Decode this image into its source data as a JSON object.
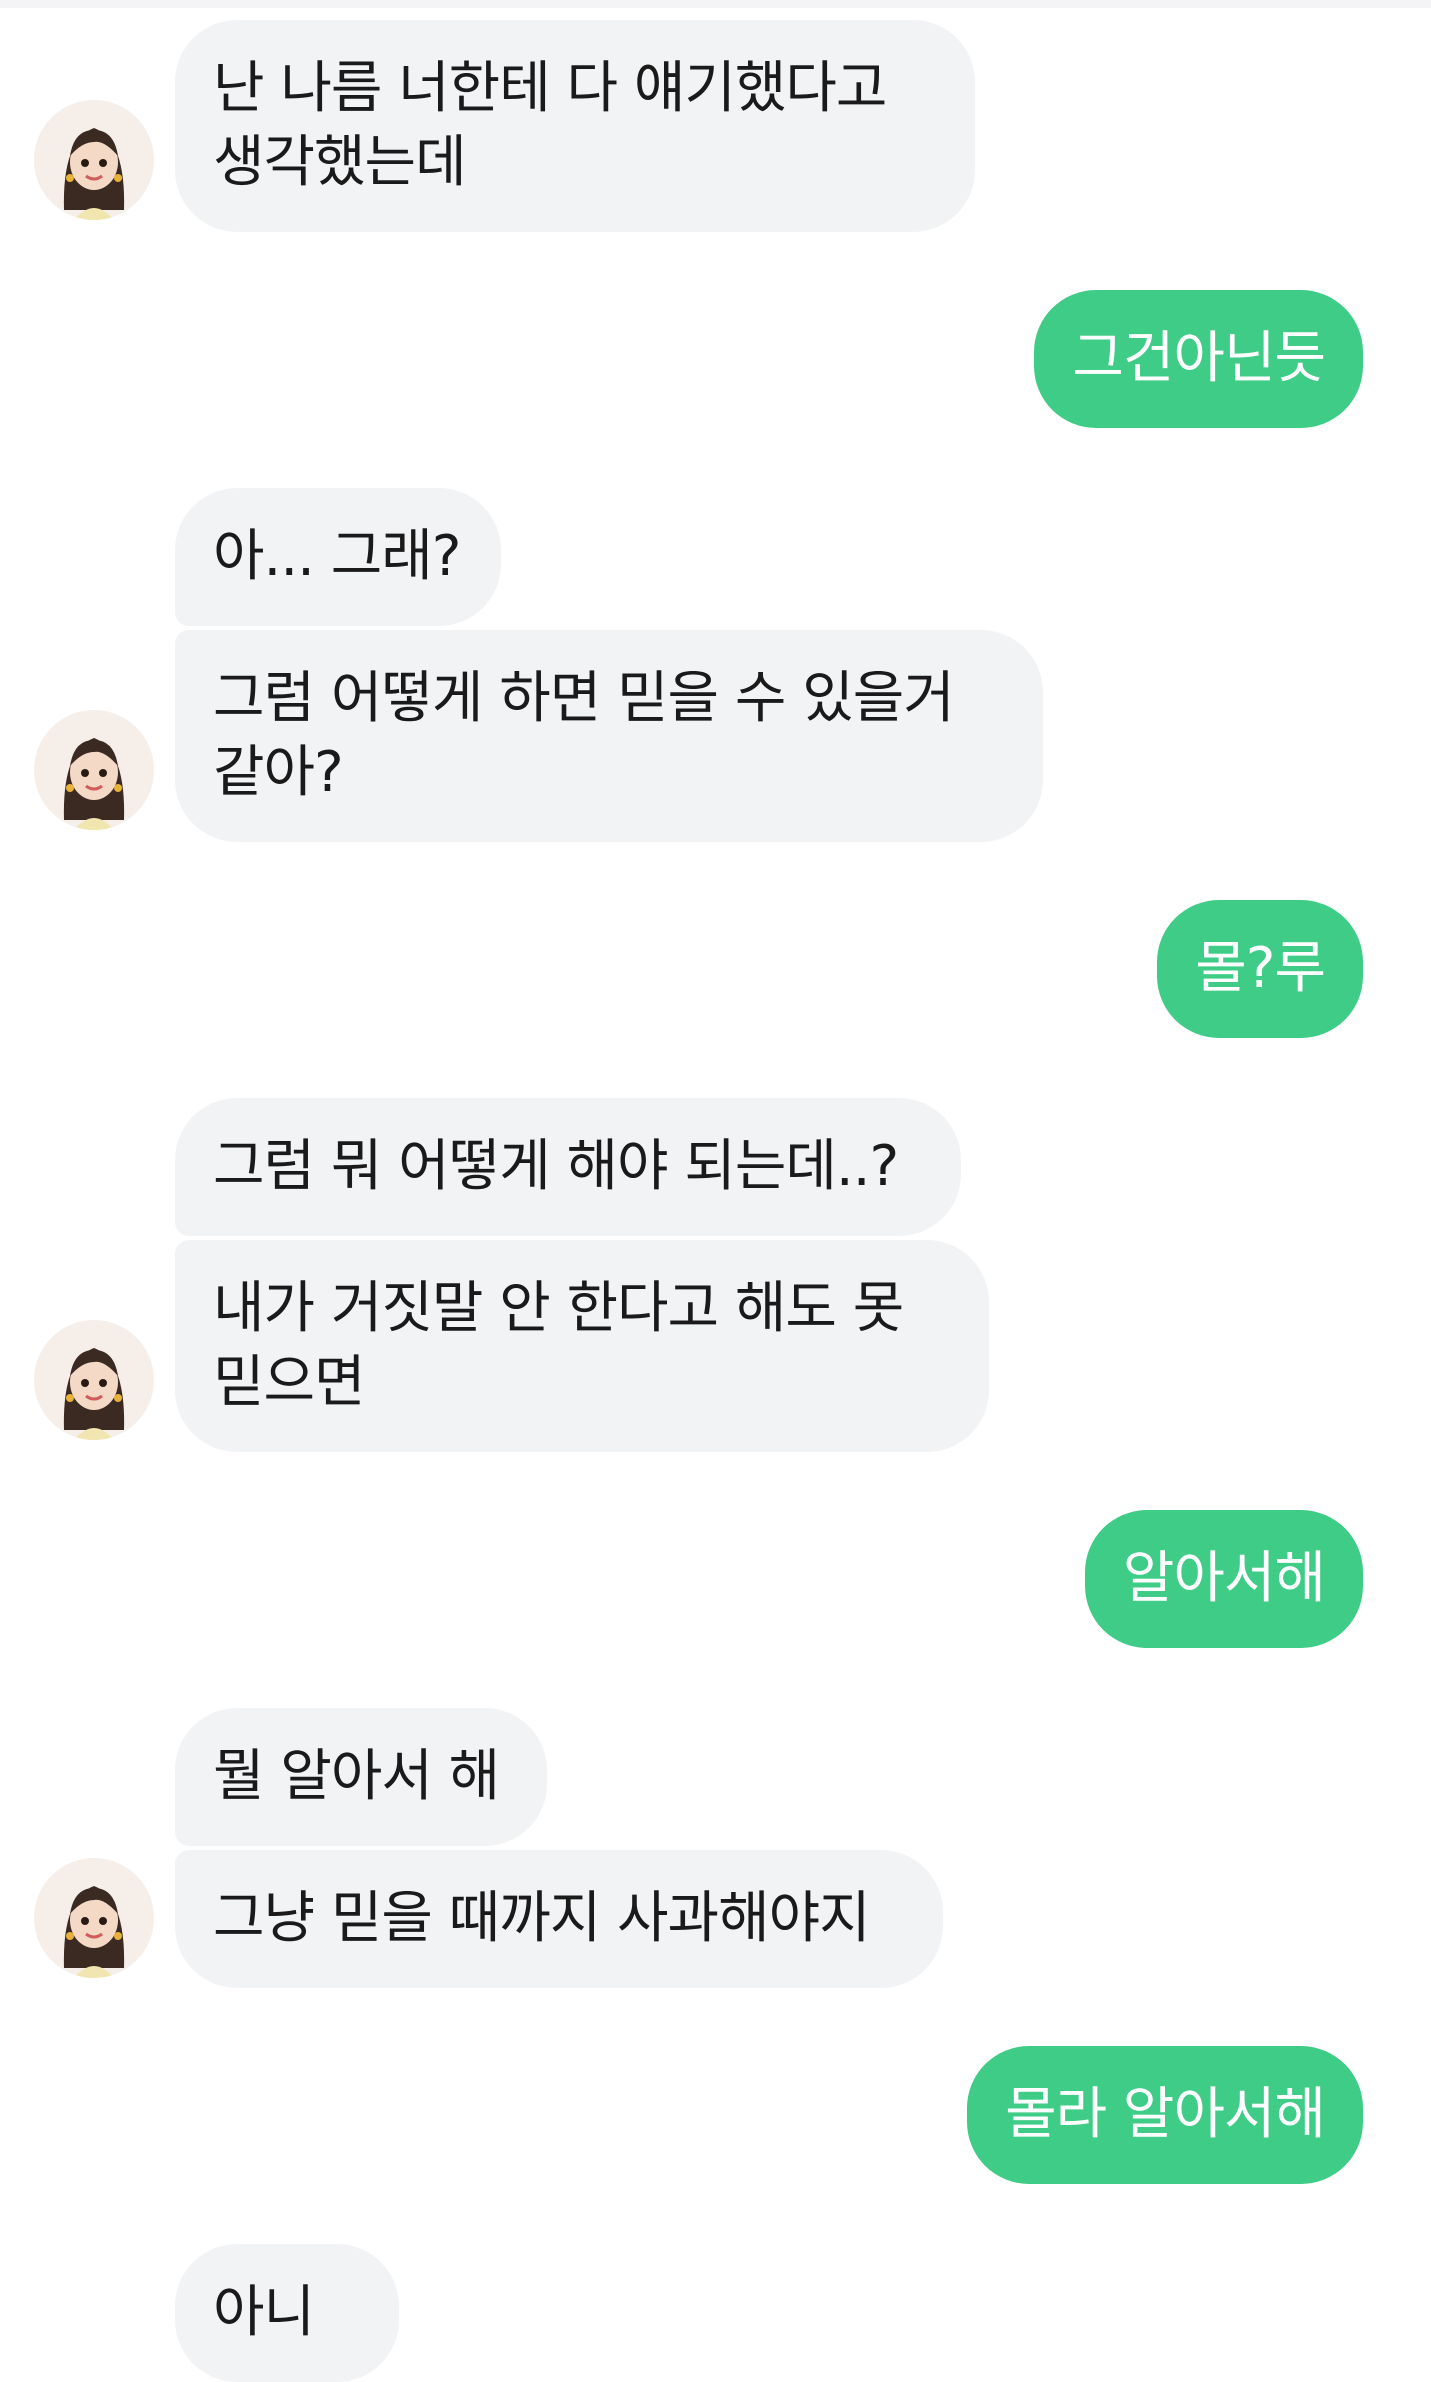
{
  "chat": {
    "messages": [
      {
        "side": "in",
        "text": "난 나름 너한테 다 얘기했다고\n생각했는데"
      },
      {
        "side": "out",
        "text": "그건아닌듯"
      },
      {
        "side": "in",
        "text": "아... 그래?"
      },
      {
        "side": "in",
        "text": "그럼 어떻게 하면 믿을 수 있을거\n같아?"
      },
      {
        "side": "out",
        "text": "몰?루"
      },
      {
        "side": "in",
        "text": "그럼 뭐 어떻게 해야 되는데..?"
      },
      {
        "side": "in",
        "text": "내가 거짓말 안 한다고 해도 못\n믿으면"
      },
      {
        "side": "out",
        "text": "알아서해"
      },
      {
        "side": "in",
        "text": "뭘 알아서 해"
      },
      {
        "side": "in",
        "text": "그냥 믿을 때까지 사과해야지"
      },
      {
        "side": "out",
        "text": "몰라 알아서해"
      },
      {
        "side": "in",
        "text": "아니"
      }
    ]
  },
  "colors": {
    "incoming_bubble": "#f2f3f5",
    "outgoing_bubble": "#3ecc87",
    "incoming_text": "#1a1a1a",
    "outgoing_text": "#ffffff"
  },
  "icons": {
    "avatar": "girl-avatar-icon"
  }
}
